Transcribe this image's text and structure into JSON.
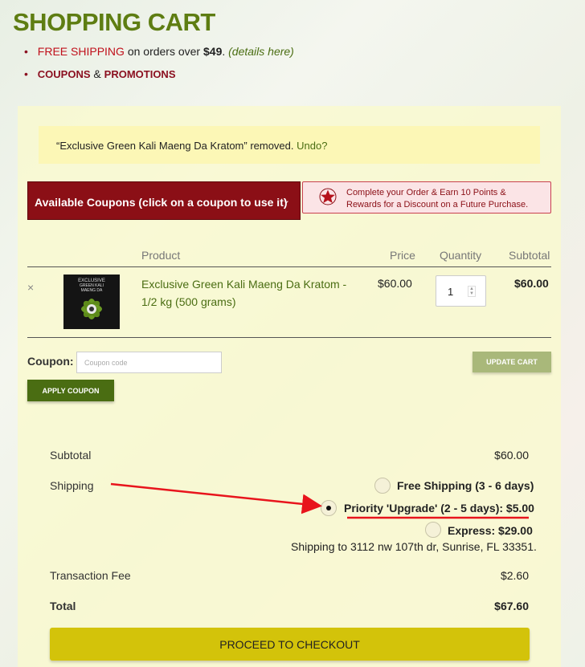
{
  "page_title": "SHOPPING CART",
  "promos": {
    "free_shipping": "FREE SHIPPING",
    "free_shipping_text": " on orders over ",
    "free_shipping_amount": "$49",
    "details_link": "(details here)",
    "coupons": "COUPONS",
    "amp": " & ",
    "promotions": "PROMOTIONS"
  },
  "notice": {
    "message": "“Exclusive Green Kali Maeng Da Kratom” removed.",
    "undo": "Undo?"
  },
  "coupons_button": {
    "label": "Available Coupons (click on a coupon to use it)",
    "chevron": "⌄"
  },
  "points_box": {
    "line1": "Complete your Order & Earn 10 Points &",
    "line2": "Rewards for a Discount on a Future Purchase."
  },
  "table": {
    "headers": {
      "product": "Product",
      "price": "Price",
      "quantity": "Quantity",
      "subtotal": "Subtotal"
    },
    "row": {
      "remove": "×",
      "name": "Exclusive Green Kali Maeng Da Kratom - 1/2 kg (500 grams)",
      "price": "$60.00",
      "quantity": "1",
      "subtotal": "$60.00",
      "thumb_text_1": "EXCLUSIVE",
      "thumb_text_2": "GREEN KALI",
      "thumb_text_3": "MAENG DA"
    }
  },
  "coupon": {
    "label": "Coupon:",
    "placeholder": "Coupon code",
    "apply": "APPLY COUPON",
    "update": "UPDATE CART"
  },
  "totals": {
    "subtotal_label": "Subtotal",
    "subtotal_value": "$60.00",
    "shipping_label": "Shipping",
    "options": [
      {
        "label": "Free Shipping (3 - 6 days)",
        "selected": false
      },
      {
        "label": "Priority 'Upgrade' (2 - 5 days): $5.00",
        "selected": true
      },
      {
        "label": "Express: $29.00",
        "selected": false
      }
    ],
    "ship_to_prefix": "Shipping to ",
    "ship_to_address": "3112 nw 107th dr, Sunrise, FL 33351",
    "ship_to_suffix": ".",
    "fee_label": "Transaction Fee",
    "fee_value": "$2.60",
    "total_label": "Total",
    "total_value": "$67.60"
  },
  "checkout": "PROCEED TO CHECKOUT",
  "colors": {
    "brand_green": "#5e7d12",
    "coupon_red": "#8b0f16",
    "checkout_yellow": "#d3c30a",
    "annotation_red": "#e8141c"
  }
}
